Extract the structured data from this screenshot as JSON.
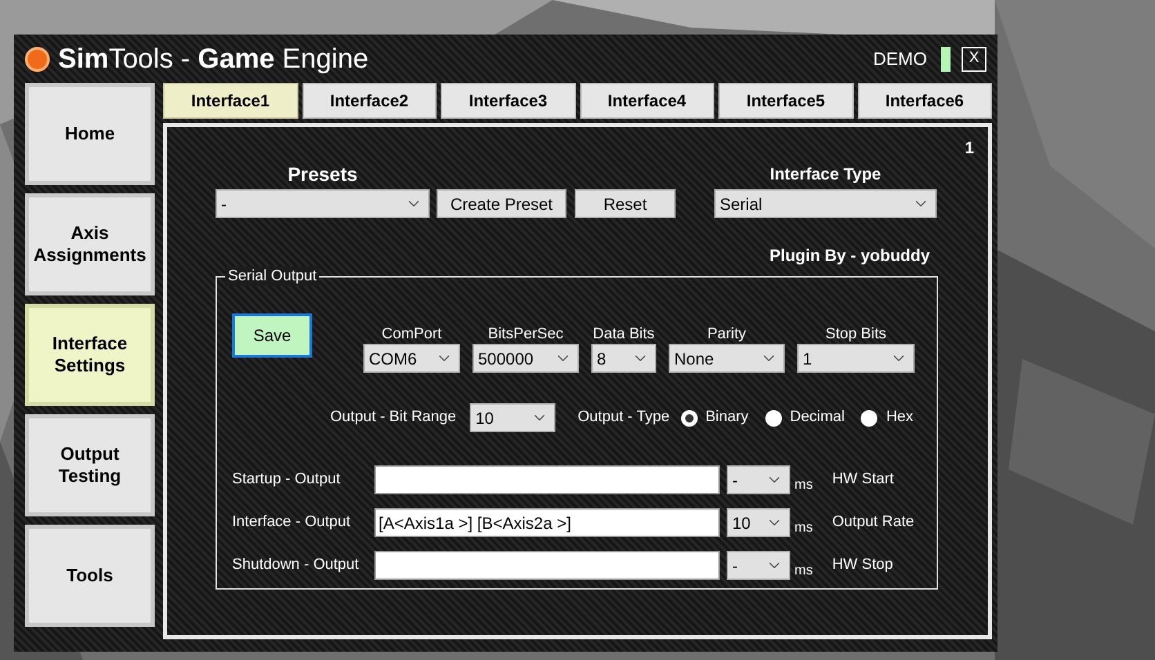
{
  "window": {
    "title": "**Sim**Tools - **Game** Engine",
    "mode": "DEMO",
    "close": "X"
  },
  "sidebar": {
    "items": [
      {
        "label": "Home",
        "selected": false
      },
      {
        "label": "Axis Assignments",
        "selected": false
      },
      {
        "label": "Interface Settings",
        "selected": true
      },
      {
        "label": "Output Testing",
        "selected": false
      },
      {
        "label": "Tools",
        "selected": false
      }
    ]
  },
  "tabs": [
    {
      "label": "Interface1",
      "selected": true
    },
    {
      "label": "Interface2",
      "selected": false
    },
    {
      "label": "Interface3",
      "selected": false
    },
    {
      "label": "Interface4",
      "selected": false
    },
    {
      "label": "Interface5",
      "selected": false
    },
    {
      "label": "Interface6",
      "selected": false
    }
  ],
  "panel": {
    "number": "1",
    "presets": {
      "label": "Presets",
      "value": "-"
    },
    "buttons": [
      "Create Preset",
      "Reset"
    ],
    "interface_type": {
      "label": "Interface Type",
      "value": "Serial"
    },
    "plugin_credit": "Plugin By - yobuddy",
    "serial_output": {
      "title": "Serial Output",
      "save_button": "Save",
      "settings": [
        {
          "label": "ComPort",
          "value": "COM6"
        },
        {
          "label": "BitsPerSec",
          "value": "500000"
        },
        {
          "label": "Data Bits",
          "value": "8"
        },
        {
          "label": "Parity",
          "value": "None"
        },
        {
          "label": "Stop Bits",
          "value": "1"
        }
      ],
      "bit_range": {
        "label": "Output - Bit Range",
        "value": "10"
      },
      "output_type": {
        "label": "Output - Type",
        "options": [
          {
            "label": "Binary",
            "selected": true
          },
          {
            "label": "Decimal",
            "selected": false
          },
          {
            "label": "Hex",
            "selected": false
          }
        ]
      },
      "outputs": [
        {
          "label": "Startup - Output",
          "interval": "-",
          "unit": "ms",
          "note": "HW Start"
        },
        {
          "label": "Interface - Output",
          "value": "[A<Axis1a >] [B<Axis2a >]",
          "interval": "10",
          "unit": "ms",
          "note": "Output Rate"
        },
        {
          "label": "Shutdown - Output",
          "interval": "-",
          "unit": "ms",
          "note": "HW Stop"
        }
      ]
    }
  }
}
